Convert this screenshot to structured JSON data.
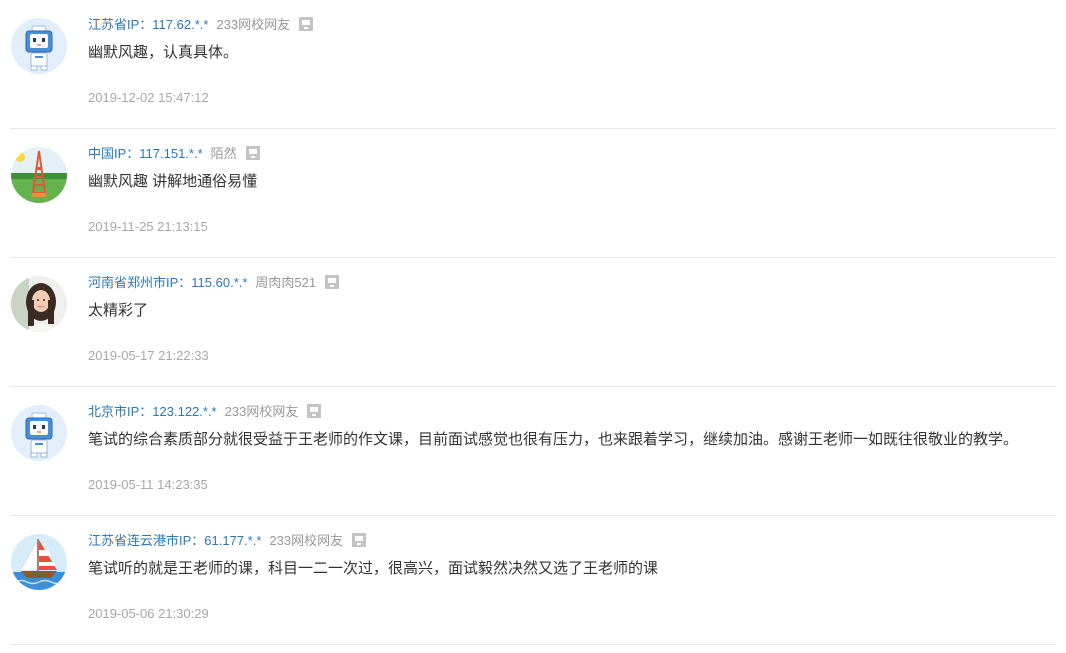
{
  "comments": [
    {
      "avatar": "robot-mascot",
      "location": "江苏省IP：117.62.*.*",
      "user": "233网校网友",
      "content": "幽默风趣，认真具体。",
      "date": "2019-12-02 15:47:12"
    },
    {
      "avatar": "tower-landscape",
      "location": "中国IP：117.151.*.*",
      "user": "陌然",
      "content": "幽默风趣 讲解地通俗易懂",
      "date": "2019-11-25 21:13:15"
    },
    {
      "avatar": "portrait-photo",
      "location": "河南省郑州市IP：115.60.*.*",
      "user": "周肉肉521",
      "content": "太精彩了",
      "date": "2019-05-17 21:22:33"
    },
    {
      "avatar": "robot-mascot",
      "location": "北京市IP：123.122.*.*",
      "user": "233网校网友",
      "content": "笔试的综合素质部分就很受益于王老师的作文课，目前面试感觉也很有压力，也来跟着学习，继续加油。感谢王老师一如既往很敬业的教学。",
      "date": "2019-05-11 14:23:35"
    },
    {
      "avatar": "sailboat",
      "location": "江苏省连云港市IP：61.177.*.*",
      "user": "233网校网友",
      "content": "笔试听的就是王老师的课，科目一二一次过，很高兴，面试毅然决然又选了王老师的课",
      "date": "2019-05-06 21:30:29"
    }
  ],
  "colors": {
    "location": "#2b78b8",
    "username": "#999999",
    "content": "#333333",
    "date": "#a8a8a8",
    "separator": "#e6e6e6"
  }
}
